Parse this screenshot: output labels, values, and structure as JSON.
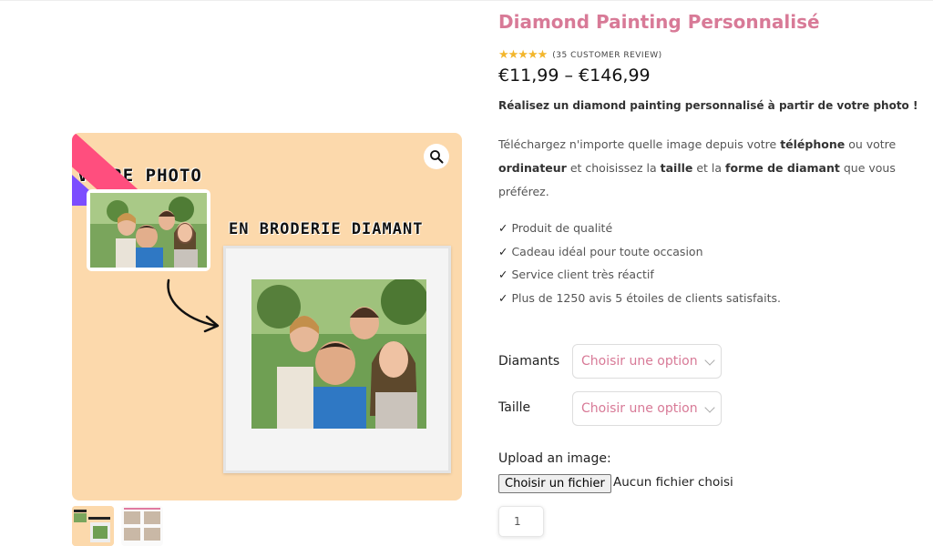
{
  "colors": {
    "accent": "#d87a97",
    "star": "#f3b62c",
    "gallery_bg": "#fcd9ac"
  },
  "gallery": {
    "headline_1": "VOTRE PHOTO",
    "headline_2": "EN BRODERIE DIAMANT",
    "zoom_icon": "search-icon"
  },
  "product": {
    "title": "Diamond Painting Personnalisé",
    "stars": "★★★★★",
    "reviews": "(35 CUSTOMER REVIEW)",
    "price": "€11,99 – €146,99",
    "lead": "Réalisez un diamond painting personnalisé à partir de votre photo !",
    "desc": {
      "p1": "Téléchargez n'importe quelle image depuis votre ",
      "b1": "téléphone",
      "p2": " ou votre ",
      "b2": "ordinateur",
      "p3": " et choisissez la ",
      "b3": "taille",
      "p4": " et la ",
      "b4": "forme de diamant",
      "p5": " que vous préférez."
    },
    "features": [
      "Produit de qualité",
      "Cadeau idéal pour toute occasion",
      "Service client très réactif",
      "Plus de 1250 avis 5 étoiles de clients satisfaits."
    ]
  },
  "options": {
    "diamants_label": "Diamants",
    "taille_label": "Taille",
    "placeholder": "Choisir une option"
  },
  "upload": {
    "label": "Upload an image:",
    "button": "Choisir un fichier",
    "status": "Aucun fichier choisi"
  },
  "quantity": {
    "value": "1"
  }
}
